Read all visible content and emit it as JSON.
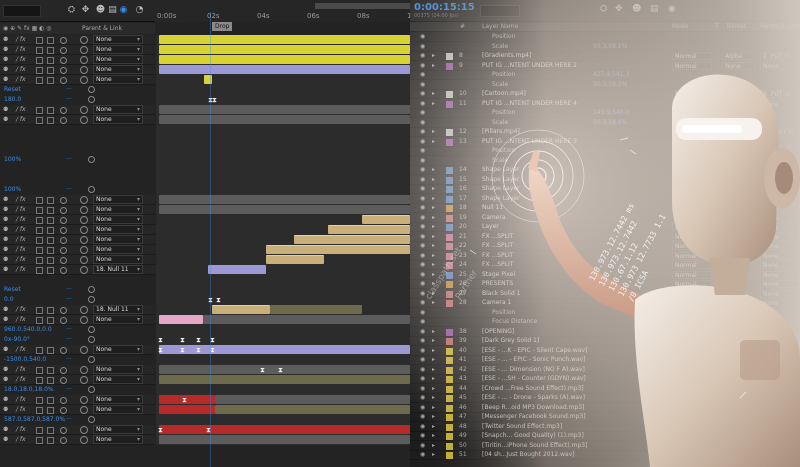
{
  "left_panel": {
    "ruler_ticks": [
      "0:00s",
      "02s",
      "04s",
      "06s",
      "08s",
      "10"
    ],
    "marker_label": "Drop",
    "header_parent": "Parent & Link",
    "colors": {
      "accent": "#3b8fe8",
      "yellow": "#d9d235",
      "lavender": "#9c98d6",
      "tan": "#c9b07a",
      "pink": "#e4a7c6",
      "red": "#b72a2a"
    }
  },
  "left_rows": [
    {
      "type": "layer",
      "parent": "None"
    },
    {
      "type": "layer",
      "parent": "None"
    },
    {
      "type": "layer",
      "parent": "None"
    },
    {
      "type": "layer",
      "parent": "None"
    },
    {
      "type": "layer",
      "parent": "None"
    },
    {
      "type": "prop",
      "value": "Reset"
    },
    {
      "type": "prop",
      "value": "180.0"
    },
    {
      "type": "layer",
      "parent": "None"
    },
    {
      "type": "layer",
      "parent": "None"
    },
    {
      "type": "blank"
    },
    {
      "type": "blank"
    },
    {
      "type": "blank"
    },
    {
      "type": "prop",
      "value": "100%"
    },
    {
      "type": "blank"
    },
    {
      "type": "blank"
    },
    {
      "type": "prop",
      "value": "100%"
    },
    {
      "type": "layer",
      "parent": "None"
    },
    {
      "type": "layer",
      "parent": "None"
    },
    {
      "type": "layer",
      "parent": "None"
    },
    {
      "type": "layer",
      "parent": "None"
    },
    {
      "type": "layer",
      "parent": "None"
    },
    {
      "type": "layer",
      "parent": "None"
    },
    {
      "type": "layer",
      "parent": "None"
    },
    {
      "type": "layer",
      "parent": "18. Null 11"
    },
    {
      "type": "blank"
    },
    {
      "type": "prop",
      "value": "Reset"
    },
    {
      "type": "prop",
      "value": "0.0"
    },
    {
      "type": "layer",
      "parent": "18. Null 11"
    },
    {
      "type": "layer",
      "parent": "None"
    },
    {
      "type": "prop",
      "value": "960.0,540.0,0.0"
    },
    {
      "type": "prop",
      "value": "0x-90.0°"
    },
    {
      "type": "layer",
      "parent": "None"
    },
    {
      "type": "prop",
      "value": "-1500.0,540.0"
    },
    {
      "type": "layer",
      "parent": "None"
    },
    {
      "type": "layer",
      "parent": "None"
    },
    {
      "type": "prop",
      "value": "18.0,18.0,18.0%"
    },
    {
      "type": "layer",
      "parent": "None"
    },
    {
      "type": "layer",
      "parent": "None"
    },
    {
      "type": "prop",
      "value": "587.0,587.0,587.0%"
    },
    {
      "type": "layer",
      "parent": "None"
    },
    {
      "type": "layer",
      "parent": "None"
    }
  ],
  "right_panel": {
    "timecode": "0:00:15:15",
    "frames": "00375 (24.00 fps)",
    "headers": {
      "num": "#",
      "name": "Layer Name",
      "mode": "Mode",
      "t": "T",
      "trkmat": "TrkMat",
      "parent": "Parent & Link"
    }
  },
  "right_rows": [
    {
      "num": "",
      "name": "Position",
      "prop": true
    },
    {
      "num": "",
      "name": "Scale",
      "prop": true,
      "pv": "56.3,59.1%"
    },
    {
      "num": "8",
      "name": "[Gradients.mp4]",
      "mode": "Normal",
      "trk": "Alpha",
      "par": "2. PUT IG",
      "lbl": "#c9c9c9"
    },
    {
      "num": "9",
      "name": "PUT IG ...NTENT UNDER HERE 2",
      "mode": "Normal",
      "trk": "None",
      "par": "None",
      "lbl": "#9a4fb0"
    },
    {
      "num": "",
      "name": "Position",
      "prop": true,
      "pv": "427.4,541.3"
    },
    {
      "num": "",
      "name": "Scale",
      "prop": true,
      "pv": "50.3,59.1%"
    },
    {
      "num": "10",
      "name": "[Cartoon.mp4]",
      "mode": "Normal",
      "trk": "Alpha",
      "par": "9. PUT IG",
      "lbl": "#c9c9c9"
    },
    {
      "num": "11",
      "name": "PUT IG ...NTENT UNDER HERE 4",
      "mode": "Normal",
      "trk": "None",
      "par": "None",
      "lbl": "#9a4fb0"
    },
    {
      "num": "",
      "name": "Position",
      "prop": true,
      "pv": "143.9,540.0"
    },
    {
      "num": "",
      "name": "Scale",
      "prop": true,
      "pv": "50.3,58.9%"
    },
    {
      "num": "12",
      "name": "[Pillars.mp4]",
      "mode": "Normal",
      "trk": "Alpha",
      "par": "11. PUT IG",
      "lbl": "#c9c9c9"
    },
    {
      "num": "13",
      "name": "PUT IG ...NTENT UNDER HERE 3",
      "mode": "Normal",
      "trk": "None",
      "par": "None",
      "lbl": "#9a4fb0"
    },
    {
      "num": "",
      "name": "Position",
      "prop": true
    },
    {
      "num": "",
      "name": "Scale",
      "prop": true
    },
    {
      "num": "14",
      "name": "Shape Layer",
      "mode": "Normal",
      "trk": "",
      "par": "None",
      "lbl": "#4a7fc0"
    },
    {
      "num": "15",
      "name": "Shape Layer",
      "mode": "Normal",
      "trk": "",
      "par": "None",
      "lbl": "#4a7fc0"
    },
    {
      "num": "16",
      "name": "Shape Layer",
      "mode": "Normal",
      "trk": "",
      "par": "None",
      "lbl": "#4a7fc0"
    },
    {
      "num": "17",
      "name": "Shape Layer",
      "mode": "Normal",
      "trk": "",
      "par": "None",
      "lbl": "#4a7fc0"
    },
    {
      "num": "18",
      "name": "Null 11",
      "mode": "Normal",
      "trk": "",
      "par": "None",
      "lbl": "#c98a2a"
    },
    {
      "num": "19",
      "name": "Camera",
      "mode": "",
      "trk": "",
      "par": "None",
      "lbl": "#c96a6a"
    },
    {
      "num": "20",
      "name": "Layer",
      "mode": "Normal",
      "trk": "",
      "par": "None",
      "lbl": "#4a7fc0"
    },
    {
      "num": "21",
      "name": "FX ...SPLIT",
      "mode": "Normal",
      "trk": "",
      "par": "None",
      "lbl": "#c96a8a"
    },
    {
      "num": "22",
      "name": "FX ...SPLIT",
      "mode": "Normal",
      "trk": "",
      "par": "None",
      "lbl": "#c96a8a"
    },
    {
      "num": "23",
      "name": "FX ...SPLIT",
      "mode": "Normal",
      "trk": "",
      "par": "None",
      "lbl": "#c96a8a"
    },
    {
      "num": "24",
      "name": "FX ...SPLIT",
      "mode": "Normal",
      "trk": "",
      "par": "None",
      "lbl": "#c96a8a"
    },
    {
      "num": "25",
      "name": "Stage Pixel",
      "mode": "Normal",
      "trk": "",
      "par": "None",
      "lbl": "#4a7fc0"
    },
    {
      "num": "26",
      "name": "PRESENTS",
      "mode": "Normal",
      "trk": "",
      "par": "None",
      "lbl": "#c98a2a"
    },
    {
      "num": "27",
      "name": "Black Solid 1",
      "mode": "Normal",
      "trk": "",
      "par": "None",
      "lbl": "#c96a6a"
    },
    {
      "num": "28",
      "name": "Camera 1",
      "mode": "",
      "trk": "",
      "par": "None",
      "lbl": "#c96a6a"
    },
    {
      "num": "",
      "name": "Position",
      "prop": true
    },
    {
      "num": "",
      "name": "Focus Distance",
      "prop": true
    },
    {
      "num": "38",
      "name": "[OPENING]",
      "mode": "Normal",
      "trk": "",
      "par": "None",
      "lbl": "#9a4fb0"
    },
    {
      "num": "39",
      "name": "[Dark Grey Solid 1]",
      "mode": "Normal",
      "trk": "",
      "par": "None",
      "lbl": "#c96a6a"
    },
    {
      "num": "40",
      "name": "[ESE - ...K - EPIC - Silent Cape.wav]",
      "mode": "",
      "trk": "",
      "par": "None",
      "lbl": "#d9c235"
    },
    {
      "num": "41",
      "name": "[ESE - ... - EPIC - Sonic Punch.wav]",
      "mode": "",
      "trk": "",
      "par": "None",
      "lbl": "#d9c235"
    },
    {
      "num": "42",
      "name": "[ESE - ... Dimension (NO F A).wav]",
      "mode": "",
      "trk": "",
      "par": "None",
      "lbl": "#d9c235"
    },
    {
      "num": "43",
      "name": "[ESE - ...SH - Counter (GDYN).wav]",
      "mode": "",
      "trk": "",
      "par": "None",
      "lbl": "#d9c235"
    },
    {
      "num": "44",
      "name": "[Crowd ...Free Sound Effect).mp3]",
      "mode": "",
      "trk": "",
      "par": "None",
      "lbl": "#d9c235"
    },
    {
      "num": "45",
      "name": "[ESE - ... - Drone - Sparks (A).wav]",
      "mode": "",
      "trk": "",
      "par": "None",
      "lbl": "#d9c235"
    },
    {
      "num": "46",
      "name": "[Beep R...oid MP3 Download.mp3]",
      "mode": "",
      "trk": "",
      "par": "None",
      "lbl": "#d9c235"
    },
    {
      "num": "47",
      "name": "[Messenger Facebook Sound.mp3]",
      "mode": "",
      "trk": "",
      "par": "None",
      "lbl": "#d9c235"
    },
    {
      "num": "48",
      "name": "[Twitter Sound Effect.mp3]",
      "mode": "",
      "trk": "",
      "par": "None",
      "lbl": "#d9c235"
    },
    {
      "num": "49",
      "name": "[Snapch... Good Quality) (1).mp3]",
      "mode": "",
      "trk": "",
      "par": "None",
      "lbl": "#d9c235"
    },
    {
      "num": "50",
      "name": "[Tiritin...iPhone Sound Effect).mp3]",
      "mode": "",
      "trk": "",
      "par": "None",
      "lbl": "#d9c235"
    },
    {
      "num": "51",
      "name": "[04 sh...Just Bought 2012.wav]",
      "mode": "",
      "trk": "",
      "par": "None",
      "lbl": "#d9c235"
    }
  ],
  "overlay_text": {
    "readout_lines": [
      "130.973.12.7442 ms",
      "130.973.12.7442",
      "130.67.1.12",
      "130.973 12.7733 1.1",
      "/0 ICSA"
    ],
    "side_text": "classpath.set",
    "side_text2": "Partner"
  }
}
